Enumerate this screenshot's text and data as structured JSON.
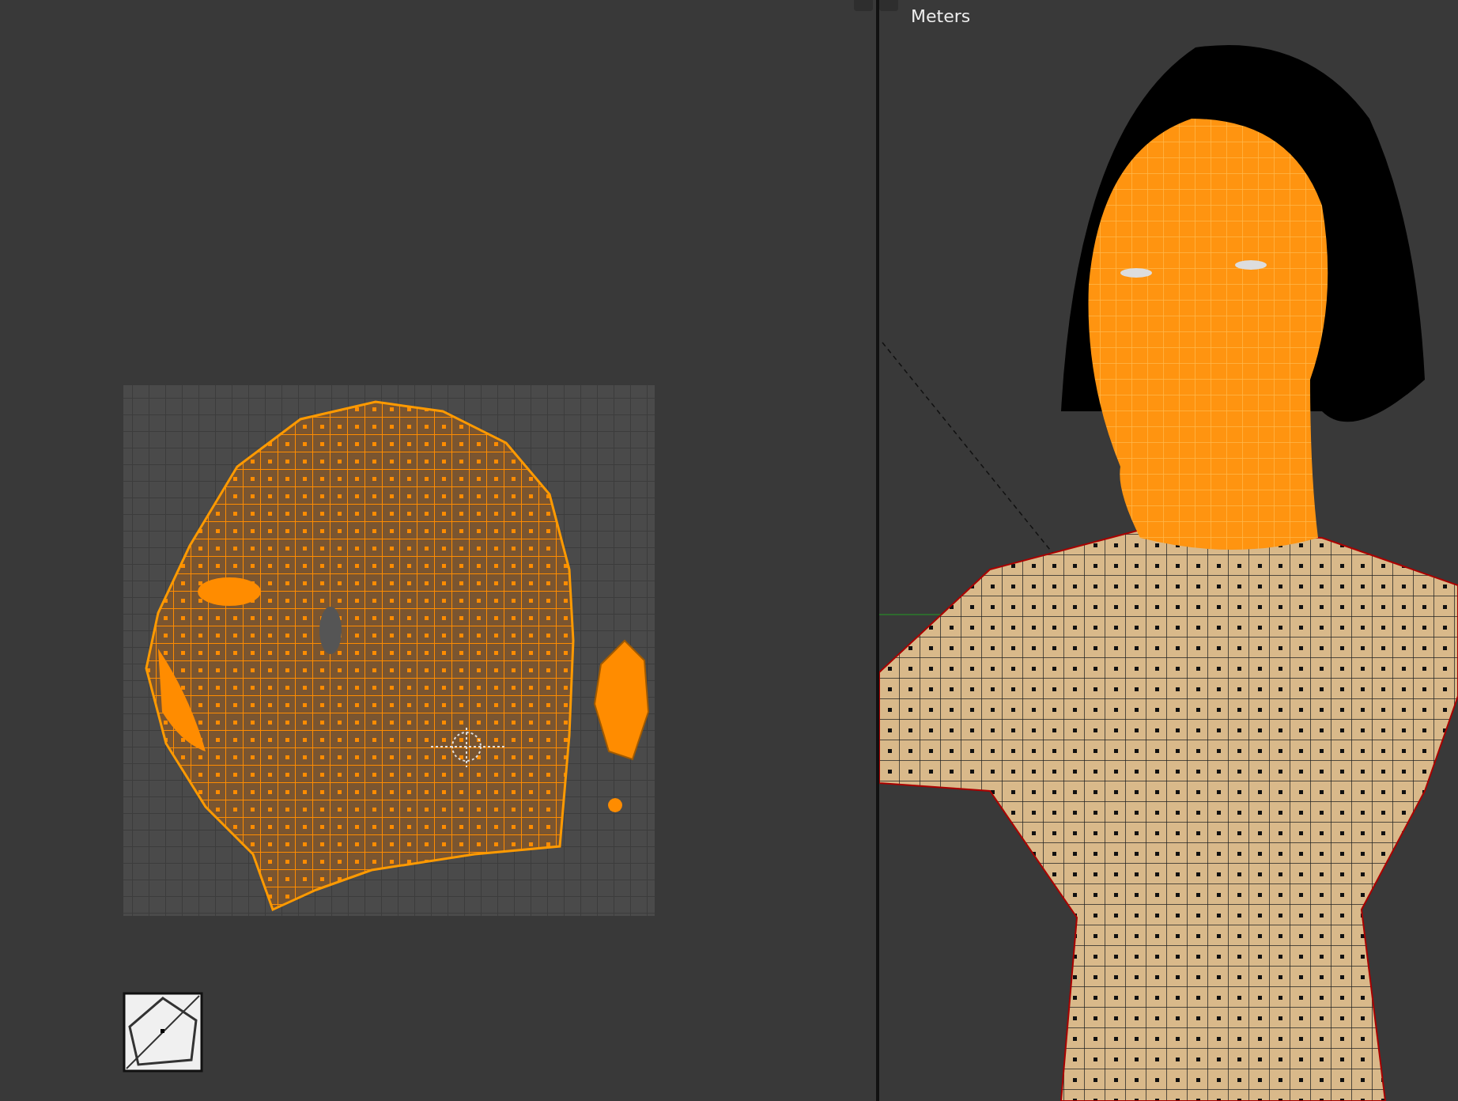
{
  "viewport_3d": {
    "units_label": "Meters"
  }
}
